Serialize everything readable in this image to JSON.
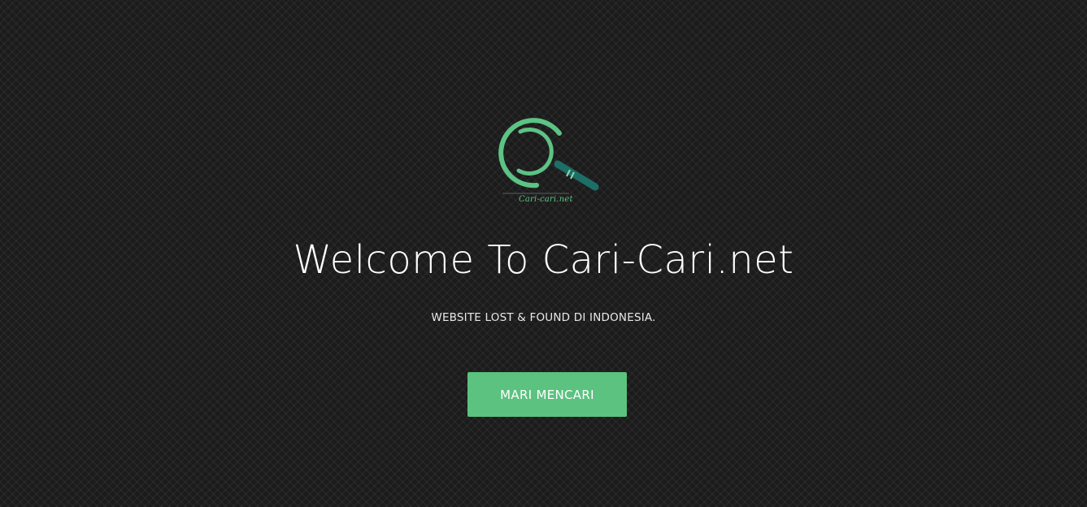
{
  "hero": {
    "logo": {
      "icon": "magnifier-logo-icon",
      "caption": "Cari-cari.net"
    },
    "title": "Welcome To Cari-Cari.net",
    "subtitle": "WEBSITE LOST & FOUND DI INDONESIA.",
    "cta_label": "MARI MENCARI"
  },
  "colors": {
    "accent": "#5bc27f",
    "handle": "#1d6e66",
    "background": "#1b1b1b"
  }
}
